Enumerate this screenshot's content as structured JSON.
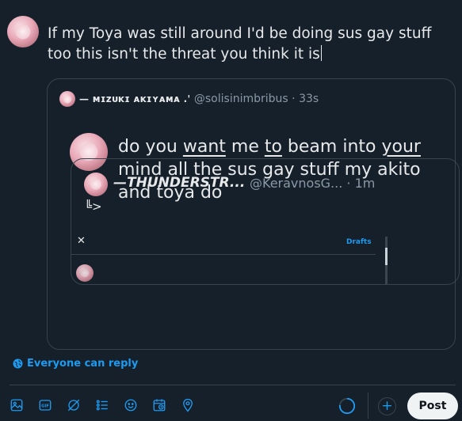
{
  "composer": {
    "text": "If my Toya was still around I'd be doing sus gay stuff too this isn't the threat you think it is"
  },
  "quote1": {
    "name": "— ᴍɪᴢᴜᴋɪ ᴀᴋɪʏᴀᴍᴀ .'",
    "handle": "@solisinimbribus",
    "dot": "·",
    "time": "33s",
    "text_parts": [
      "do you ",
      "want",
      " me ",
      "to",
      " beam into ",
      "your",
      " mind all the sus gay stuff my akito and toya do"
    ]
  },
  "quote2": {
    "name": "—THUNDERSTR...",
    "handle": "@KeravnosG...",
    "dot": "·",
    "time": "1m",
    "symbol": "╚>",
    "close": "✕",
    "drafts": "Drafts"
  },
  "reply": {
    "label": "Everyone can reply"
  },
  "toolbar": {
    "icons": [
      "image-icon",
      "gif-icon",
      "grok-icon",
      "poll-icon",
      "emoji-icon",
      "schedule-icon",
      "location-icon"
    ],
    "post_label": "Post"
  },
  "colors": {
    "accent": "#1d9bf0",
    "background": "#15202b",
    "border": "#38444d",
    "muted": "#8b98a5"
  }
}
